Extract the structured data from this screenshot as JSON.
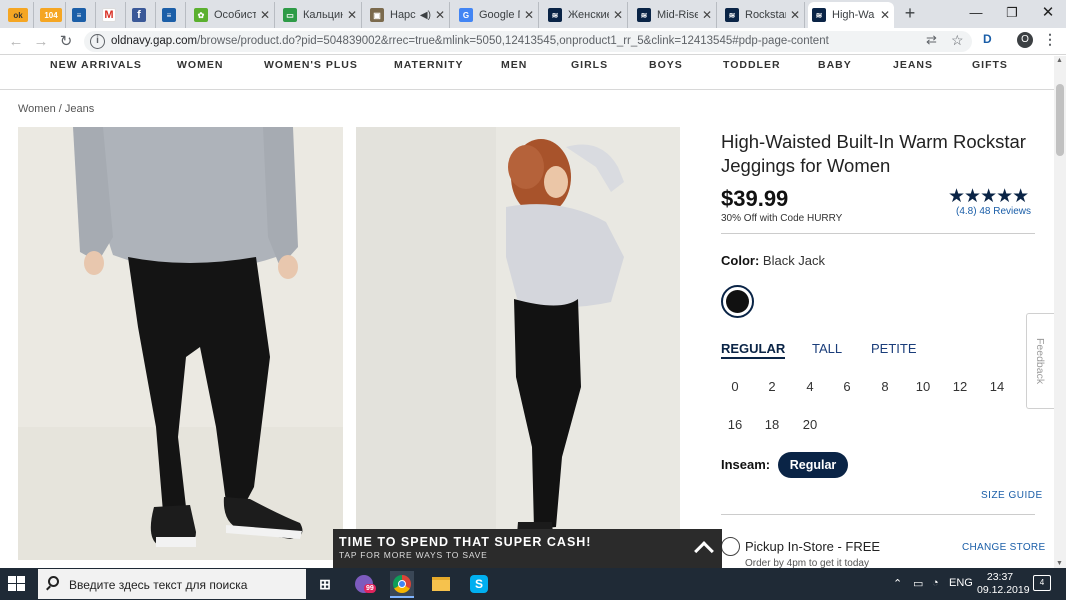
{
  "browser": {
    "tabs": [
      {
        "title": "ok",
        "favicon_color": "#f5a623",
        "favicon_text": "ok"
      },
      {
        "title": "104",
        "favicon_color": "#f5a623",
        "favicon_text": "104"
      },
      {
        "title": "",
        "favicon_color": "#1c5fa8",
        "favicon_text": "≡"
      },
      {
        "title": "",
        "favicon_color": "#d93025",
        "favicon_text": "M"
      },
      {
        "title": "",
        "favicon_color": "#3b5998",
        "favicon_text": "f"
      },
      {
        "title": "",
        "favicon_color": "#1c5fa8",
        "favicon_text": "≡"
      },
      {
        "title": "Особист",
        "favicon_color": "#5bb02f",
        "favicon_text": "✿"
      },
      {
        "title": "Кальцин",
        "favicon_color": "#2e9b47",
        "favicon_text": "▭"
      },
      {
        "title": "Нарс",
        "favicon_color": "#7b6a4d",
        "favicon_text": "▣"
      },
      {
        "title": "Google Г",
        "favicon_color": "#4285f4",
        "favicon_text": "G"
      },
      {
        "title": "Женские",
        "favicon_color": "#0a2446",
        "favicon_text": "≋"
      },
      {
        "title": "Mid-Rise",
        "favicon_color": "#0a2446",
        "favicon_text": "≋"
      },
      {
        "title": "Rockstar",
        "favicon_color": "#0a2446",
        "favicon_text": "≋"
      },
      {
        "title": "High-Wa",
        "favicon_color": "#0a2446",
        "favicon_text": "≋"
      }
    ],
    "new_tab_label": "+",
    "url_host": "oldnavy.gap.com",
    "url_rest": "/browse/product.do?pid=504839002&rrec=true&mlink=5050,12413545,onproduct1_rr_5&clink=12413545#pdp-page-content",
    "profile_initial": "O"
  },
  "site": {
    "nav": [
      "NEW ARRIVALS",
      "WOMEN",
      "WOMEN'S PLUS",
      "MATERNITY",
      "MEN",
      "GIRLS",
      "BOYS",
      "TODDLER",
      "BABY",
      "JEANS",
      "GIFTS"
    ],
    "breadcrumb": "Women / Jeans"
  },
  "product": {
    "title": "High-Waisted Built-In Warm Rockstar Jeggings for Women",
    "price": "$39.99",
    "promo": "30% Off with Code HURRY",
    "stars": "★★★★★",
    "rating_text": "(4.8) 48 Reviews",
    "color_label": "Color:",
    "color_value": "Black Jack",
    "swatch_color": "#111111",
    "fits": [
      "REGULAR",
      "TALL",
      "PETITE"
    ],
    "sizes_row1": [
      "0",
      "2",
      "4",
      "6",
      "8",
      "10",
      "12",
      "14"
    ],
    "sizes_row2": [
      "16",
      "18",
      "20"
    ],
    "inseam_label": "Inseam:",
    "inseam_value": "Regular",
    "size_guide": "SIZE GUIDE",
    "pickup_label": "Pickup In-Store - FREE",
    "pickup_sub": "Order by 4pm to get it today",
    "change_store": "CHANGE STORE"
  },
  "feedback_label": "Feedback",
  "promo_banner": {
    "title": "TIME TO SPEND THAT SUPER CASH!",
    "subtitle": "TAP FOR MORE WAYS TO SAVE"
  },
  "taskbar": {
    "search_placeholder": "Введите здесь текст для поиска",
    "viber_badge": "99",
    "language": "ENG",
    "time": "23:37",
    "date": "09.12.2019",
    "notification_count": "4"
  },
  "colors": {
    "brand_navy": "#0a2446",
    "link_blue": "#1a5ea8",
    "promo_bar": "#2b2b2b"
  }
}
